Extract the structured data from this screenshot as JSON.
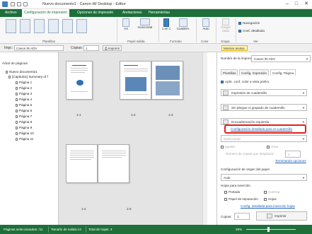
{
  "window": {
    "title": "Nuevo documento1 - Canon iW Desktop - Editor",
    "minimize": "–",
    "maximize": "□",
    "close": "✕"
  },
  "tabs": [
    "Archivo",
    "Configuración de impresión",
    "Opciones de impresión",
    "Anotaciones",
    "Herramientas"
  ],
  "ribbon": {
    "groups": {
      "plantillas": "Plantillas",
      "papel_salida": "Papel salida",
      "formato": "Formato",
      "color": "Color",
      "grapa": "Grapa",
      "ver": "Ver"
    },
    "paper_size": "A4",
    "orientation": "Horizontal",
    "one_on": "1 en 1",
    "booklet": "Cuadern.",
    "color_mode": "Auto",
    "staple": "Grapa/ nada",
    "navegacion": "Navegación",
    "conf_detallada": "Conf. detallada"
  },
  "toolbar2": {
    "impr_label": "Impr.:",
    "printer": "Canon iR-ADV",
    "copias_label": "Copias:",
    "copias_value": "1",
    "imprimir": "Imprimir",
    "mostrar_anotac": "Mostrar anotac."
  },
  "tree": {
    "title": "Árbol de páginas",
    "root": "Nuevo documento1",
    "doc": "[Capítulo1] Summary of f",
    "pages": [
      "Página 1",
      "Página 2",
      "Página 3",
      "Página 4",
      "Página 5",
      "Página 6",
      "Página 7",
      "Página 8",
      "Página 9",
      "Página 10",
      "Página 11"
    ]
  },
  "preview": {
    "labels": [
      "1-1",
      "1-2",
      "1-3",
      "1-4",
      "1-5"
    ]
  },
  "panel": {
    "printer_name": "Nombre de la impresora:",
    "printer_value": "Canon iR-ADV",
    "tabs": [
      "Plantillas",
      "Config. Impresión",
      "Config. Página"
    ],
    "aplic_conf": "Aplic. conf. color a vista prelim.",
    "impresion_cuadernillo": "Impresión de cuadernillo",
    "sin_pliegue": "Sin pliegue ni grapado de cuadernillo",
    "encuadernacion": "Encuadernación izquierda",
    "config_link": "Configuración detallada para el cuadernillo",
    "seleccionar": "Seleccionar",
    "igualar": "Igualar",
    "girar": "Girar",
    "numero_copias": "Número de copias que desplazar:",
    "numero_value": "1",
    "terminando": "Terminando opciones",
    "config_origen": "Configuración de origen del papel",
    "auto": "Auto",
    "hojas_insercion": "Hojas para inserción",
    "portada": "Portada",
    "contrap": "Contrap.",
    "papel_separacion": "Papel de separación",
    "hojas": "Hojas",
    "config_hojas_link": "Config. detallada para inserción hojas",
    "copias_label": "Copias:",
    "copias_value": "1",
    "imprimir": "Imprimir"
  },
  "status": {
    "pages_selected": "Páginas seleccionadas: /11",
    "paper_size": "Tamaño de salida:A4",
    "total_sheets": "Total de hojas: 3",
    "zoom": "25%"
  }
}
